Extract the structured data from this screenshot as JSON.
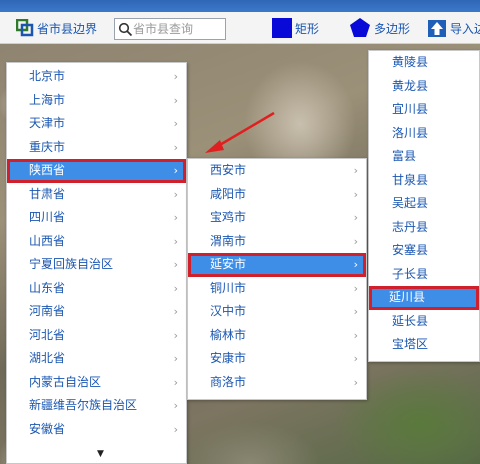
{
  "toolbar": {
    "boundary_label": "省市县边界",
    "search_placeholder": "省市县查询",
    "rect_label": "矩形",
    "polygon_label": "多边形",
    "import_label": "导入边"
  },
  "colors": {
    "toolbar_blue": "#1a56b0",
    "selected_bg": "#3e8ee8",
    "selected_border": "#d0202c",
    "annotation_arrow": "#e02020"
  },
  "provinces": [
    {
      "label": "北京市"
    },
    {
      "label": "上海市"
    },
    {
      "label": "天津市"
    },
    {
      "label": "重庆市"
    },
    {
      "label": "陕西省",
      "selected": true
    },
    {
      "label": "甘肃省"
    },
    {
      "label": "四川省"
    },
    {
      "label": "山西省"
    },
    {
      "label": "宁夏回族自治区"
    },
    {
      "label": "山东省"
    },
    {
      "label": "河南省"
    },
    {
      "label": "河北省"
    },
    {
      "label": "湖北省"
    },
    {
      "label": "内蒙古自治区"
    },
    {
      "label": "新疆维吾尔族自治区"
    },
    {
      "label": "安徽省"
    }
  ],
  "cities": [
    {
      "label": "西安市"
    },
    {
      "label": "咸阳市"
    },
    {
      "label": "宝鸡市"
    },
    {
      "label": "渭南市"
    },
    {
      "label": "延安市",
      "selected": true
    },
    {
      "label": "铜川市"
    },
    {
      "label": "汉中市"
    },
    {
      "label": "榆林市"
    },
    {
      "label": "安康市"
    },
    {
      "label": "商洛市"
    }
  ],
  "counties": [
    {
      "label": "黄陵县"
    },
    {
      "label": "黄龙县"
    },
    {
      "label": "宜川县"
    },
    {
      "label": "洛川县"
    },
    {
      "label": "富县"
    },
    {
      "label": "甘泉县"
    },
    {
      "label": "吴起县"
    },
    {
      "label": "志丹县"
    },
    {
      "label": "安塞县"
    },
    {
      "label": "子长县"
    },
    {
      "label": "延川县",
      "selected": true
    },
    {
      "label": "延长县"
    },
    {
      "label": "宝塔区"
    }
  ]
}
